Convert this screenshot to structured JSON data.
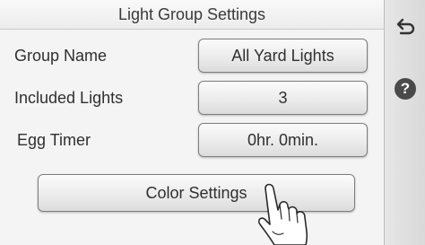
{
  "header": {
    "title": "Light Group Settings"
  },
  "settings": [
    {
      "label": "Group Name",
      "value": "All Yard Lights"
    },
    {
      "label": "Included Lights",
      "value": "3"
    },
    {
      "label": "Egg Timer",
      "value": "0hr. 0min."
    }
  ],
  "color_settings_label": "Color Settings",
  "sidebar": {
    "back_icon": "back-arrow-icon",
    "help_icon": "help-icon",
    "help_symbol": "?"
  },
  "overlay": {
    "pointer_icon": "pointing-hand-icon"
  }
}
